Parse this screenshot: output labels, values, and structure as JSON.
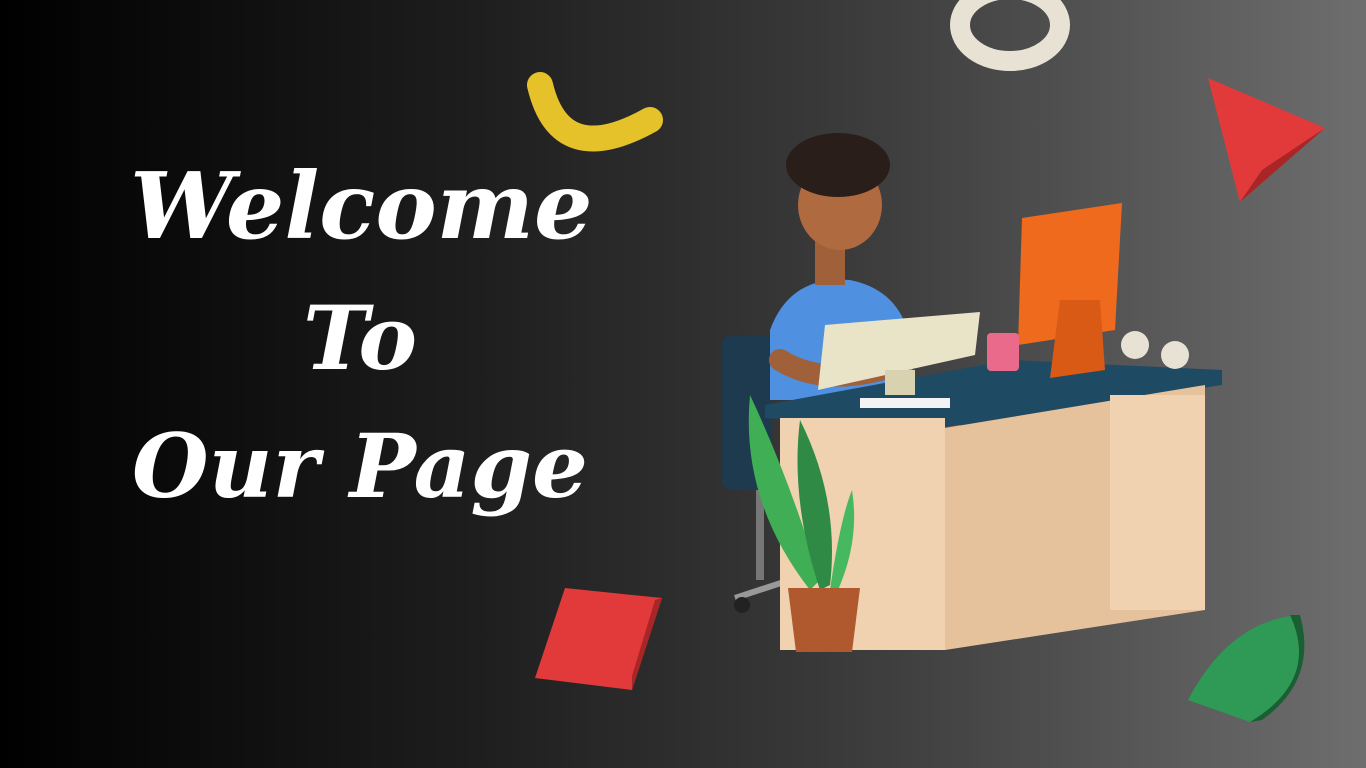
{
  "headline": {
    "line1": "Welcome",
    "line2": "To",
    "line3": "Our Page"
  },
  "colors": {
    "background_left": "#000000",
    "background_right": "#6e6e6e",
    "text": "#ffffff",
    "yellow_shape": "#e6c22a",
    "red_shape": "#e23a3a",
    "green_shape": "#2f9a55",
    "torus": "#e8e2d4",
    "monitor": "#f06a1e",
    "desk_top": "#1f4a63",
    "desk_body": "#f0d2b0",
    "shirt": "#4f90e0"
  },
  "icons": [
    "yellow-arc-shape",
    "torus-shape",
    "red-cone-shape",
    "red-block-shape",
    "green-half-disc-shape",
    "person-at-desk-illustration"
  ]
}
